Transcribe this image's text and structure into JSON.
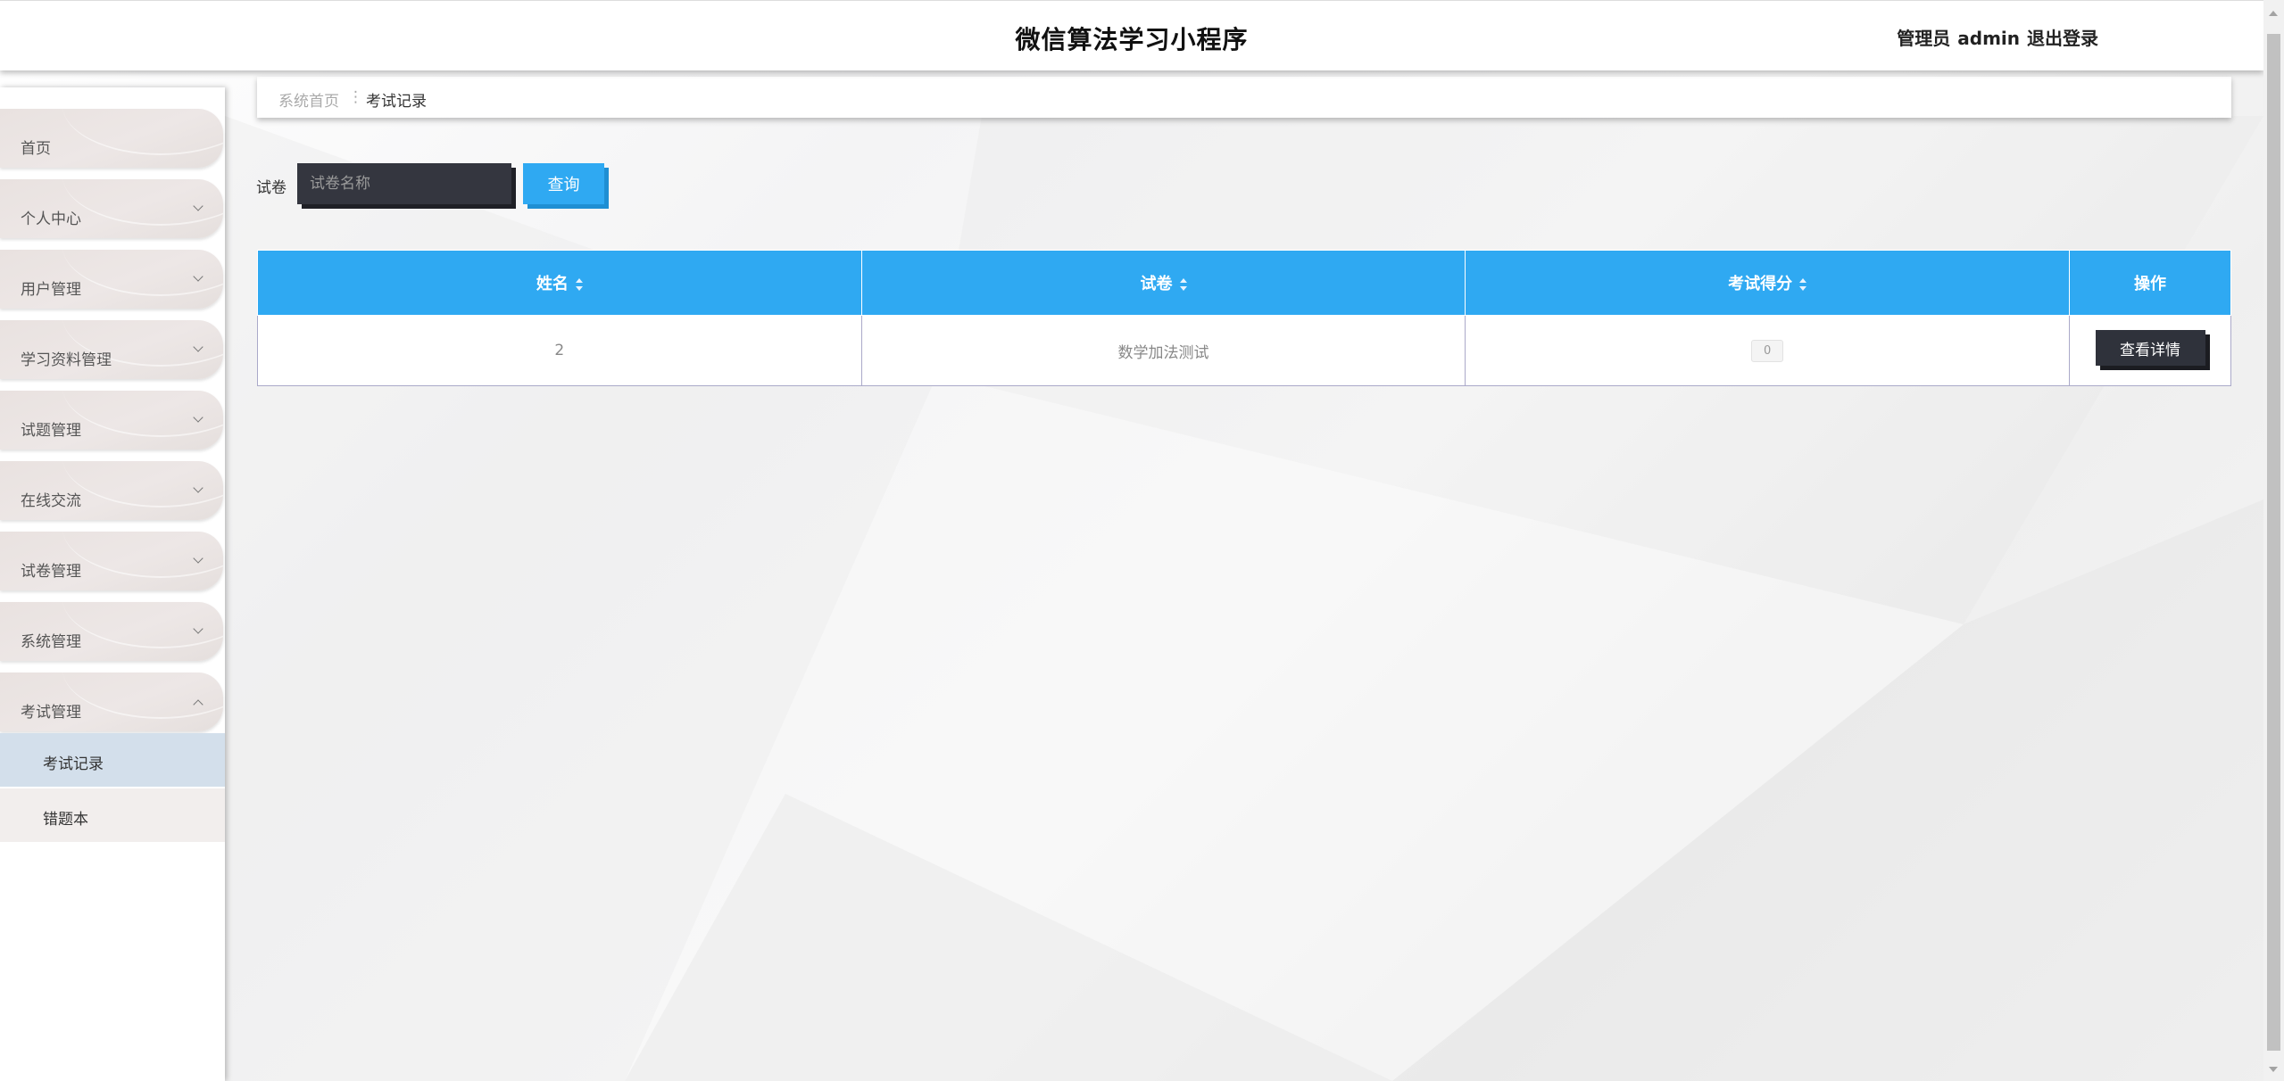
{
  "header": {
    "title": "微信算法学习小程序",
    "role": "管理员",
    "username": "admin",
    "logout_label": "退出登录"
  },
  "sidebar": {
    "items": [
      {
        "label": "首页",
        "has_arrow": false
      },
      {
        "label": "个人中心",
        "has_arrow": true
      },
      {
        "label": "用户管理",
        "has_arrow": true
      },
      {
        "label": "学习资料管理",
        "has_arrow": true
      },
      {
        "label": "试题管理",
        "has_arrow": true
      },
      {
        "label": "在线交流",
        "has_arrow": true
      },
      {
        "label": "试卷管理",
        "has_arrow": true
      },
      {
        "label": "系统管理",
        "has_arrow": true
      },
      {
        "label": "考试管理",
        "has_arrow": true,
        "expanded": true
      }
    ],
    "sub_items": [
      {
        "label": "考试记录",
        "active": true
      },
      {
        "label": "错题本",
        "active": false
      }
    ]
  },
  "breadcrumb": {
    "home": "系统首页",
    "current": "考试记录"
  },
  "search": {
    "label": "试卷",
    "placeholder": "试卷名称",
    "button_label": "查询"
  },
  "table": {
    "columns": [
      "姓名",
      "试卷",
      "考试得分",
      "操作"
    ],
    "rows": [
      {
        "name": "2",
        "paper": "数学加法测试",
        "score": "0",
        "action_label": "查看详情"
      }
    ]
  },
  "colors": {
    "accent": "#2fa9f2",
    "dark": "#2f323b",
    "active_sub": "#d3dfeb"
  }
}
